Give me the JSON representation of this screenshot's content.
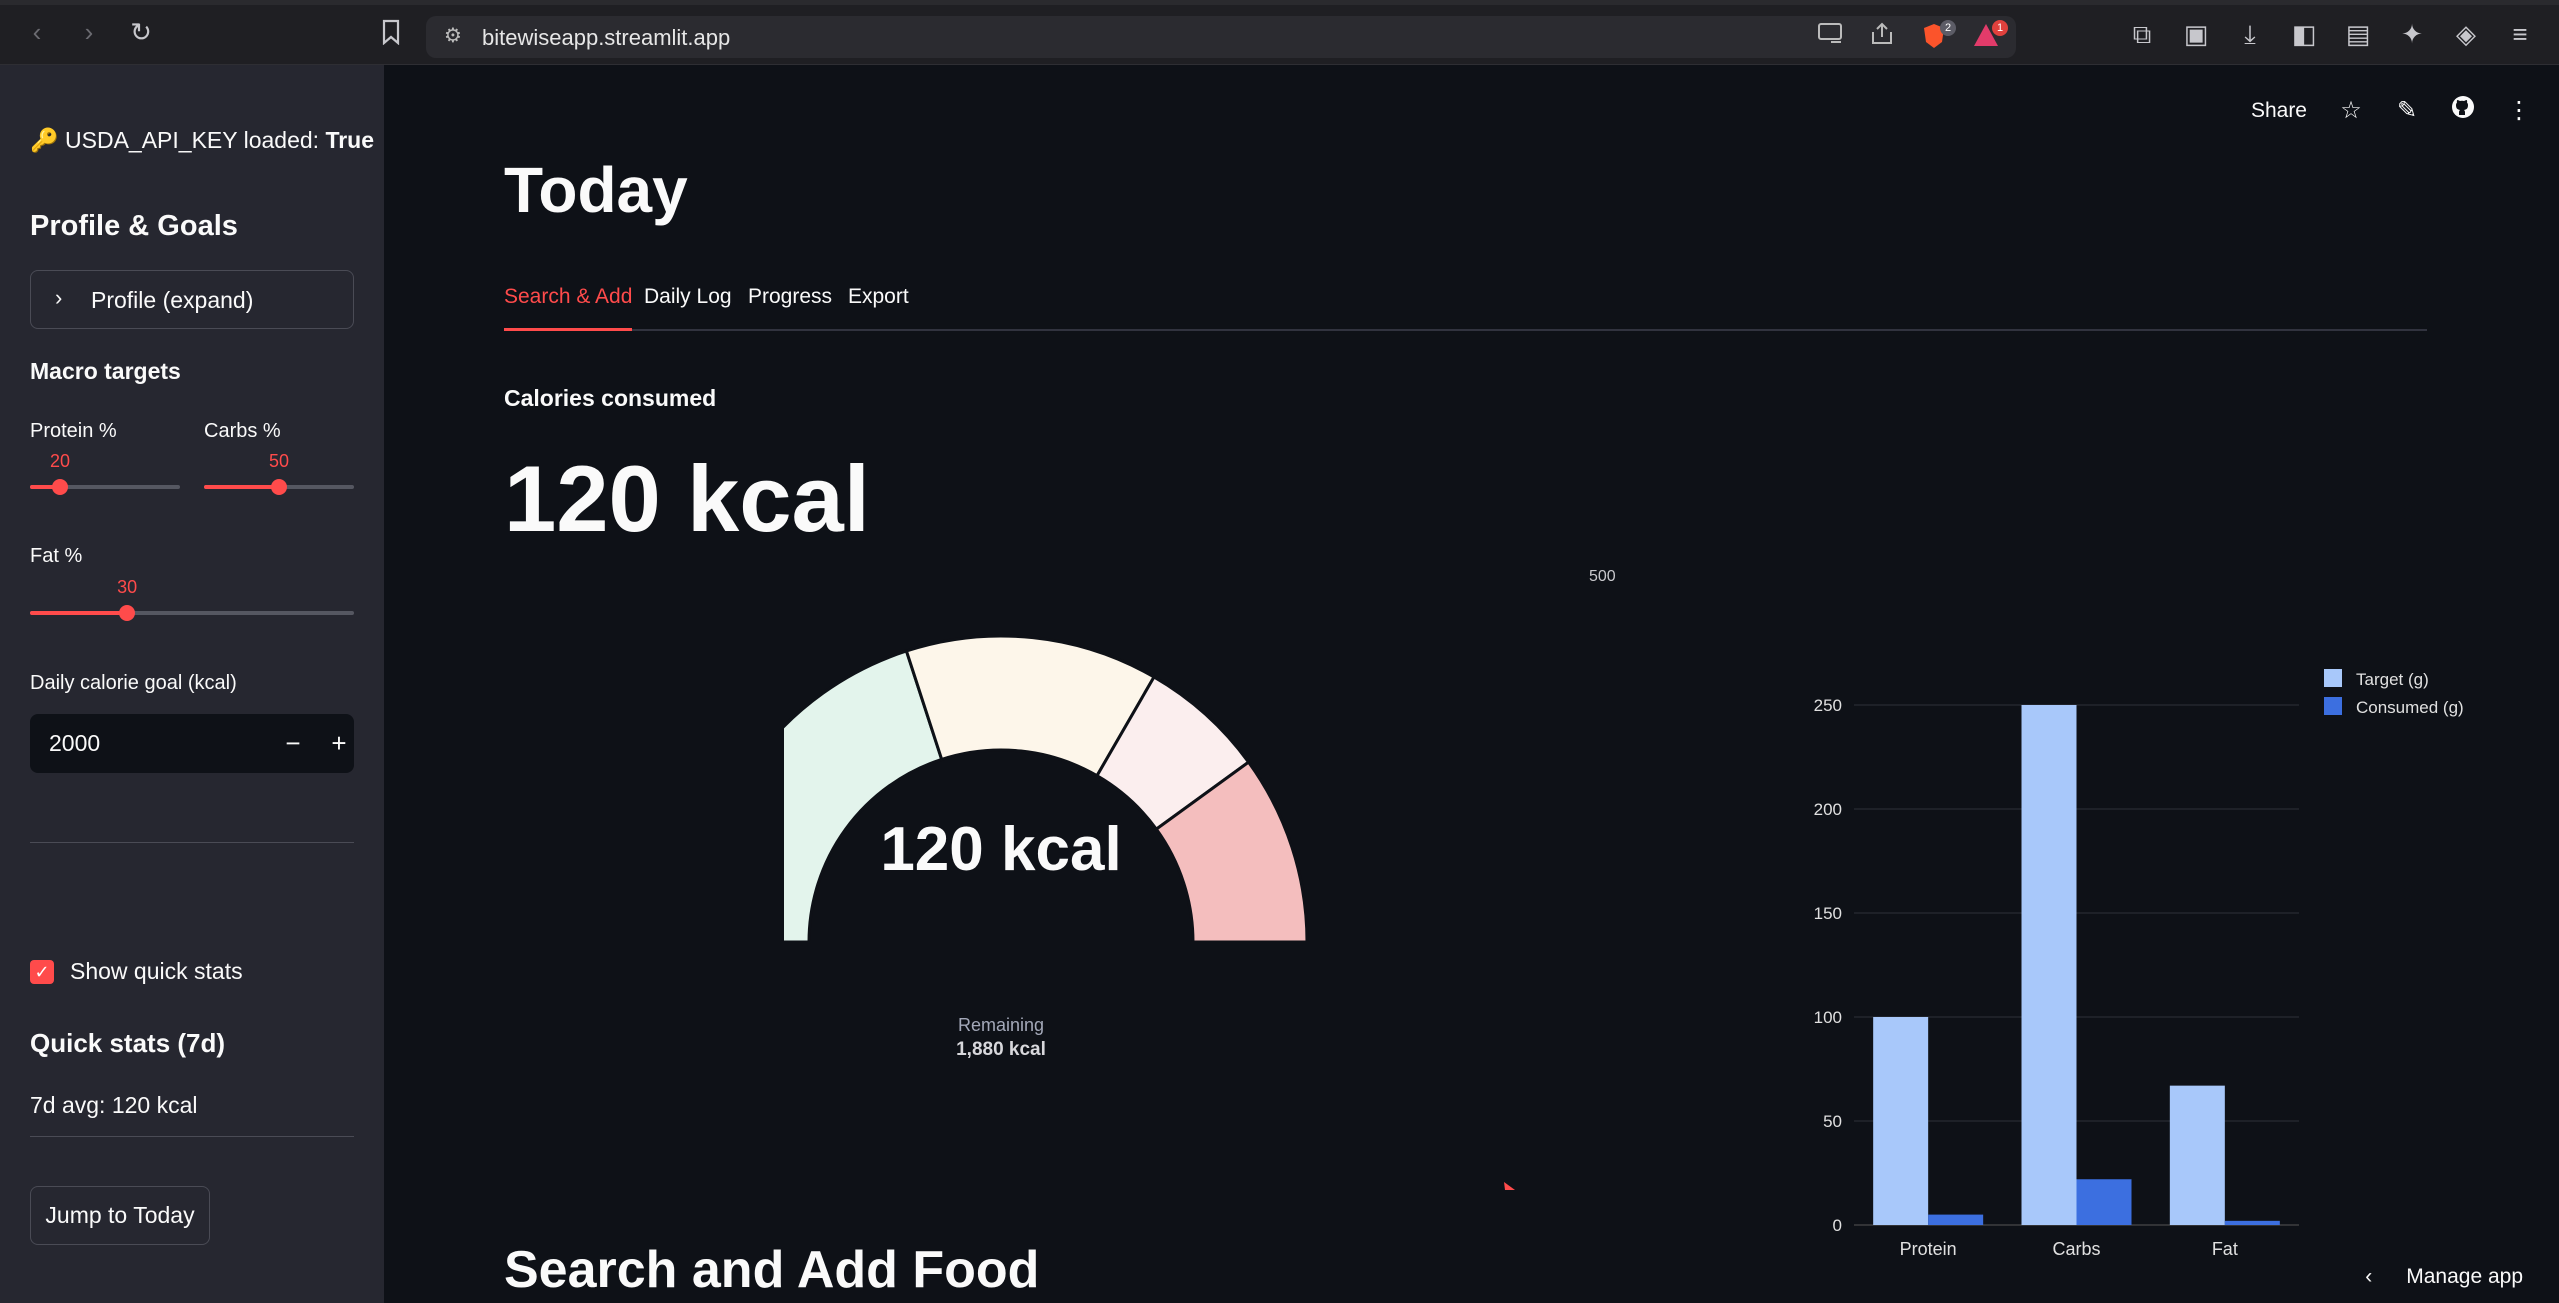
{
  "browser": {
    "url": "bitewiseapp.streamlit.app",
    "brave_badge": "2",
    "alert_badge": "1"
  },
  "sidebar": {
    "api_key_prefix": "🔑 USDA_API_KEY loaded:",
    "api_key_status": "True",
    "profile_goals_heading": "Profile & Goals",
    "profile_expander_label": "Profile (expand)",
    "macro_heading": "Macro targets",
    "protein_label": "Protein %",
    "protein_value": 20,
    "carbs_label": "Carbs %",
    "carbs_value": 50,
    "fat_label": "Fat %",
    "fat_value": 30,
    "calorie_goal_label": "Daily calorie goal (kcal)",
    "calorie_goal_value": "2000",
    "show_stats_label": "Show quick stats",
    "quick_stats_heading": "Quick stats (7d)",
    "quick_stats_text": "7d avg: 120 kcal",
    "jump_button": "Jump to Today"
  },
  "toolbar": {
    "share": "Share"
  },
  "main": {
    "title": "Today",
    "tabs": [
      "Search & Add",
      "Daily Log",
      "Progress",
      "Export"
    ],
    "active_tab": 0,
    "metric_label": "Calories consumed",
    "metric_value": "120 kcal",
    "section_heading": "Search and Add Food",
    "manage_app": "Manage app"
  },
  "gauge": {
    "value_label": "120 kcal",
    "remaining_label": "Remaining",
    "remaining_value": "1,880 kcal",
    "consumed": 120,
    "goal": 2000,
    "corner_tick": "500"
  },
  "chart_data": {
    "type": "bar",
    "categories": [
      "Protein",
      "Carbs",
      "Fat"
    ],
    "series": [
      {
        "name": "Target (g)",
        "values": [
          100,
          250,
          67
        ],
        "color": "#a8c8fa"
      },
      {
        "name": "Consumed (g)",
        "values": [
          5,
          22,
          2
        ],
        "color": "#3c6fe0"
      }
    ],
    "ylim": [
      0,
      250
    ],
    "yticks": [
      0,
      50,
      100,
      150,
      200,
      250
    ],
    "legend": "top-right",
    "grid": true
  }
}
